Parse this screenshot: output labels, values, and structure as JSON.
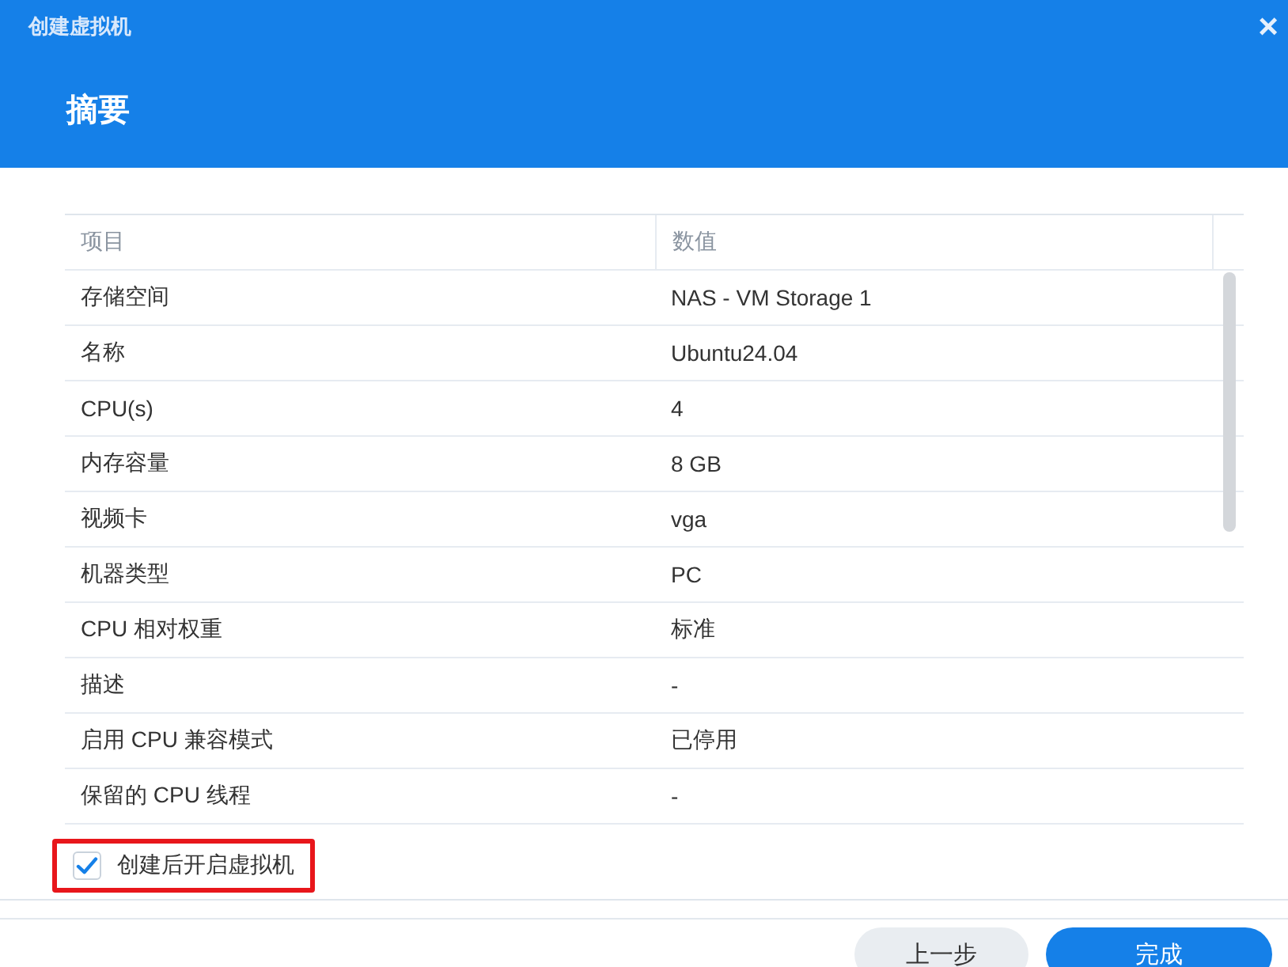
{
  "window": {
    "title": "创建虚拟机",
    "close": "×"
  },
  "heading": "摘要",
  "table": {
    "columns": [
      "项目",
      "数值"
    ],
    "rows": [
      {
        "item": "存储空间",
        "value": "NAS - VM Storage 1"
      },
      {
        "item": "名称",
        "value": "Ubuntu24.04"
      },
      {
        "item": "CPU(s)",
        "value": "4"
      },
      {
        "item": "内存容量",
        "value": "8 GB"
      },
      {
        "item": "视频卡",
        "value": "vga"
      },
      {
        "item": "机器类型",
        "value": "PC"
      },
      {
        "item": "CPU 相对权重",
        "value": "标准"
      },
      {
        "item": "描述",
        "value": "-"
      },
      {
        "item": "启用 CPU 兼容模式",
        "value": "已停用"
      },
      {
        "item": "保留的 CPU 线程",
        "value": "-"
      }
    ]
  },
  "start_option": {
    "label": "创建后开启虚拟机",
    "checked": true,
    "highlighted": true
  },
  "buttons": [
    {
      "label": "上一步",
      "kind": "secondary"
    },
    {
      "label": "完成",
      "kind": "primary"
    }
  ]
}
